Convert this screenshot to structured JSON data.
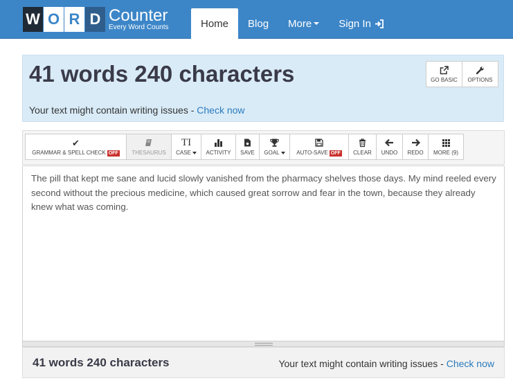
{
  "brand": {
    "letters": [
      "W",
      "O",
      "R",
      "D"
    ],
    "name": "Counter",
    "tagline": "Every Word Counts"
  },
  "nav": {
    "home": "Home",
    "blog": "Blog",
    "more": "More",
    "signin": "Sign In"
  },
  "stats": {
    "headline": "41 words 240 characters",
    "issues_text": "Your text might contain writing issues - ",
    "issues_link": "Check now",
    "go_basic": "GO BASIC",
    "options": "OPTIONS"
  },
  "toolbar": {
    "grammar": "GRAMMAR & SPELL CHECK",
    "grammar_badge": "OFF",
    "thesaurus": "THESAURUS",
    "case_icon": "TI",
    "case": "CASE",
    "activity": "ACTIVITY",
    "save": "SAVE",
    "goal": "GOAL",
    "autosave": "AUTO-SAVE",
    "autosave_badge": "OFF",
    "clear": "CLEAR",
    "undo": "UNDO",
    "redo": "REDO",
    "more": "MORE (9)"
  },
  "editor": {
    "text": "The pill that kept me sane and lucid slowly vanished from the pharmacy shelves those days. My mind reeled every second without the precious medicine, which caused great sorrow and fear in the town, because they already knew what was coming."
  },
  "footer": {
    "count": "41 words 240 characters",
    "issues_text": "Your text might contain writing issues - ",
    "issues_link": "Check now"
  },
  "colors": {
    "navbar": "#3c86c8",
    "stats_bg": "#d9ebf7",
    "link": "#2b7bbd",
    "badge": "#c9302c"
  }
}
